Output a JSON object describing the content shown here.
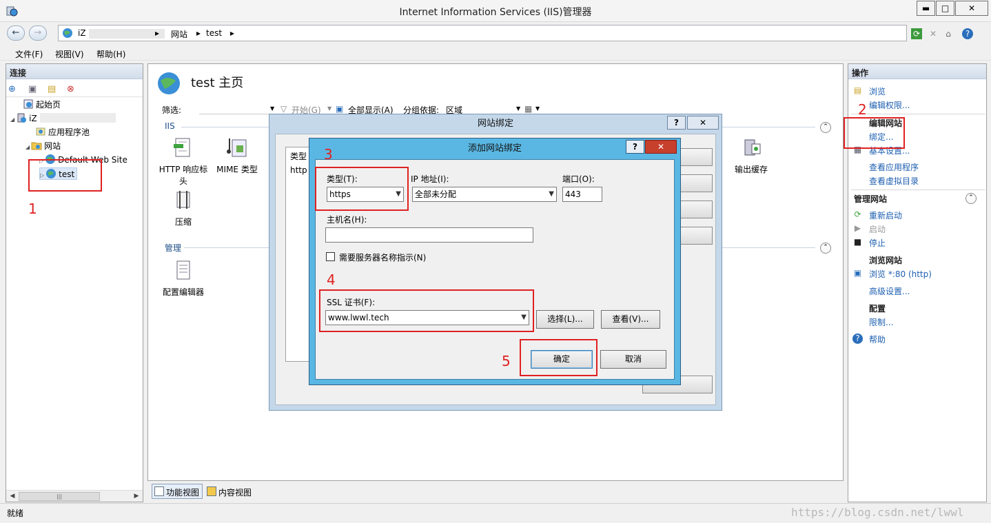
{
  "window": {
    "title": "Internet Information Services (IIS)管理器",
    "min_glyph": "▬",
    "max_glyph": "□",
    "close_glyph": "✕"
  },
  "address": {
    "crumbs": [
      "iZ",
      "网站",
      "test"
    ],
    "separator": "▸",
    "back_glyph": "←",
    "forward_glyph": "→",
    "help_glyph": "?"
  },
  "menu": [
    "文件(F)",
    "视图(V)",
    "帮助(H)"
  ],
  "left_panel": {
    "header": "连接",
    "tree": [
      {
        "label": "起始页",
        "icon": "start-page-icon"
      },
      {
        "label": "iZ",
        "icon": "server-icon"
      },
      {
        "label": "应用程序池",
        "icon": "app-pool-icon"
      },
      {
        "label": "网站",
        "icon": "sites-folder-icon"
      },
      {
        "label": "Default Web Site",
        "icon": "globe-icon"
      },
      {
        "label": "test",
        "icon": "globe-icon"
      }
    ],
    "scroll_thumb": "|||"
  },
  "center": {
    "title": "test 主页",
    "filter_label": "筛选:",
    "start_label": "开始(G)",
    "show_all_label": "全部显示(A)",
    "group_label": "分组依据:",
    "group_value": "区域",
    "iis_section": "IIS",
    "manage_section": "管理",
    "features": [
      {
        "label": "HTTP 响应标头",
        "icon": "http-response-headers-icon"
      },
      {
        "label": "MIME 类型",
        "icon": "mime-types-icon"
      },
      {
        "label": "压缩",
        "icon": "compression-icon"
      },
      {
        "label": "输出缓存",
        "icon": "output-caching-icon"
      },
      {
        "label": "配置编辑器",
        "icon": "configuration-editor-icon"
      }
    ],
    "view_tabs": [
      "功能视图",
      "内容视图"
    ]
  },
  "actions": {
    "header": "操作",
    "browse": "浏览",
    "edit_permissions": "编辑权限...",
    "edit_site_heading": "编辑网站",
    "bindings": "绑定...",
    "basic_settings": "基本设置...",
    "view_applications": "查看应用程序",
    "view_virtual_dirs": "查看虚拟目录",
    "manage_site_heading": "管理网站",
    "restart": "重新启动",
    "start": "启动",
    "stop": "停止",
    "browse_site_heading": "浏览网站",
    "browse_80": "浏览 *:80 (http)",
    "advanced_settings": "高级设置...",
    "config_heading": "配置",
    "limits": "限制...",
    "help": "帮助"
  },
  "status": {
    "text": "就绪",
    "watermark": "https://blog.csdn.net/lwwl"
  },
  "bindings_dialog": {
    "title": "网站绑定",
    "help_label": "?",
    "close_label": "✕",
    "col_type": "类型",
    "row_type": "http",
    "btn_add": "...",
    "btn_edit": "...",
    "btn_remove": "",
    "btn_browse": "",
    "btn_close": ""
  },
  "add_binding_dialog": {
    "title": "添加网站绑定",
    "help_label": "?",
    "close_label": "✕",
    "type_label": "类型(T):",
    "type_value": "https",
    "ip_label": "IP 地址(I):",
    "ip_value": "全部未分配",
    "port_label": "端口(O):",
    "port_value": "443",
    "host_label": "主机名(H):",
    "host_value": "",
    "sni_label": "需要服务器名称指示(N)",
    "sni_checked": false,
    "ssl_label": "SSL 证书(F):",
    "ssl_value": "www.lwwl.tech",
    "select_btn": "选择(L)...",
    "view_btn": "查看(V)...",
    "ok_btn": "确定",
    "cancel_btn": "取消"
  },
  "annotations": [
    "1",
    "2",
    "3",
    "4",
    "5"
  ],
  "colors": {
    "annotation_red": "#e02020",
    "dialog_blue": "#5ab7e3",
    "link_blue": "#1d5fb0"
  }
}
